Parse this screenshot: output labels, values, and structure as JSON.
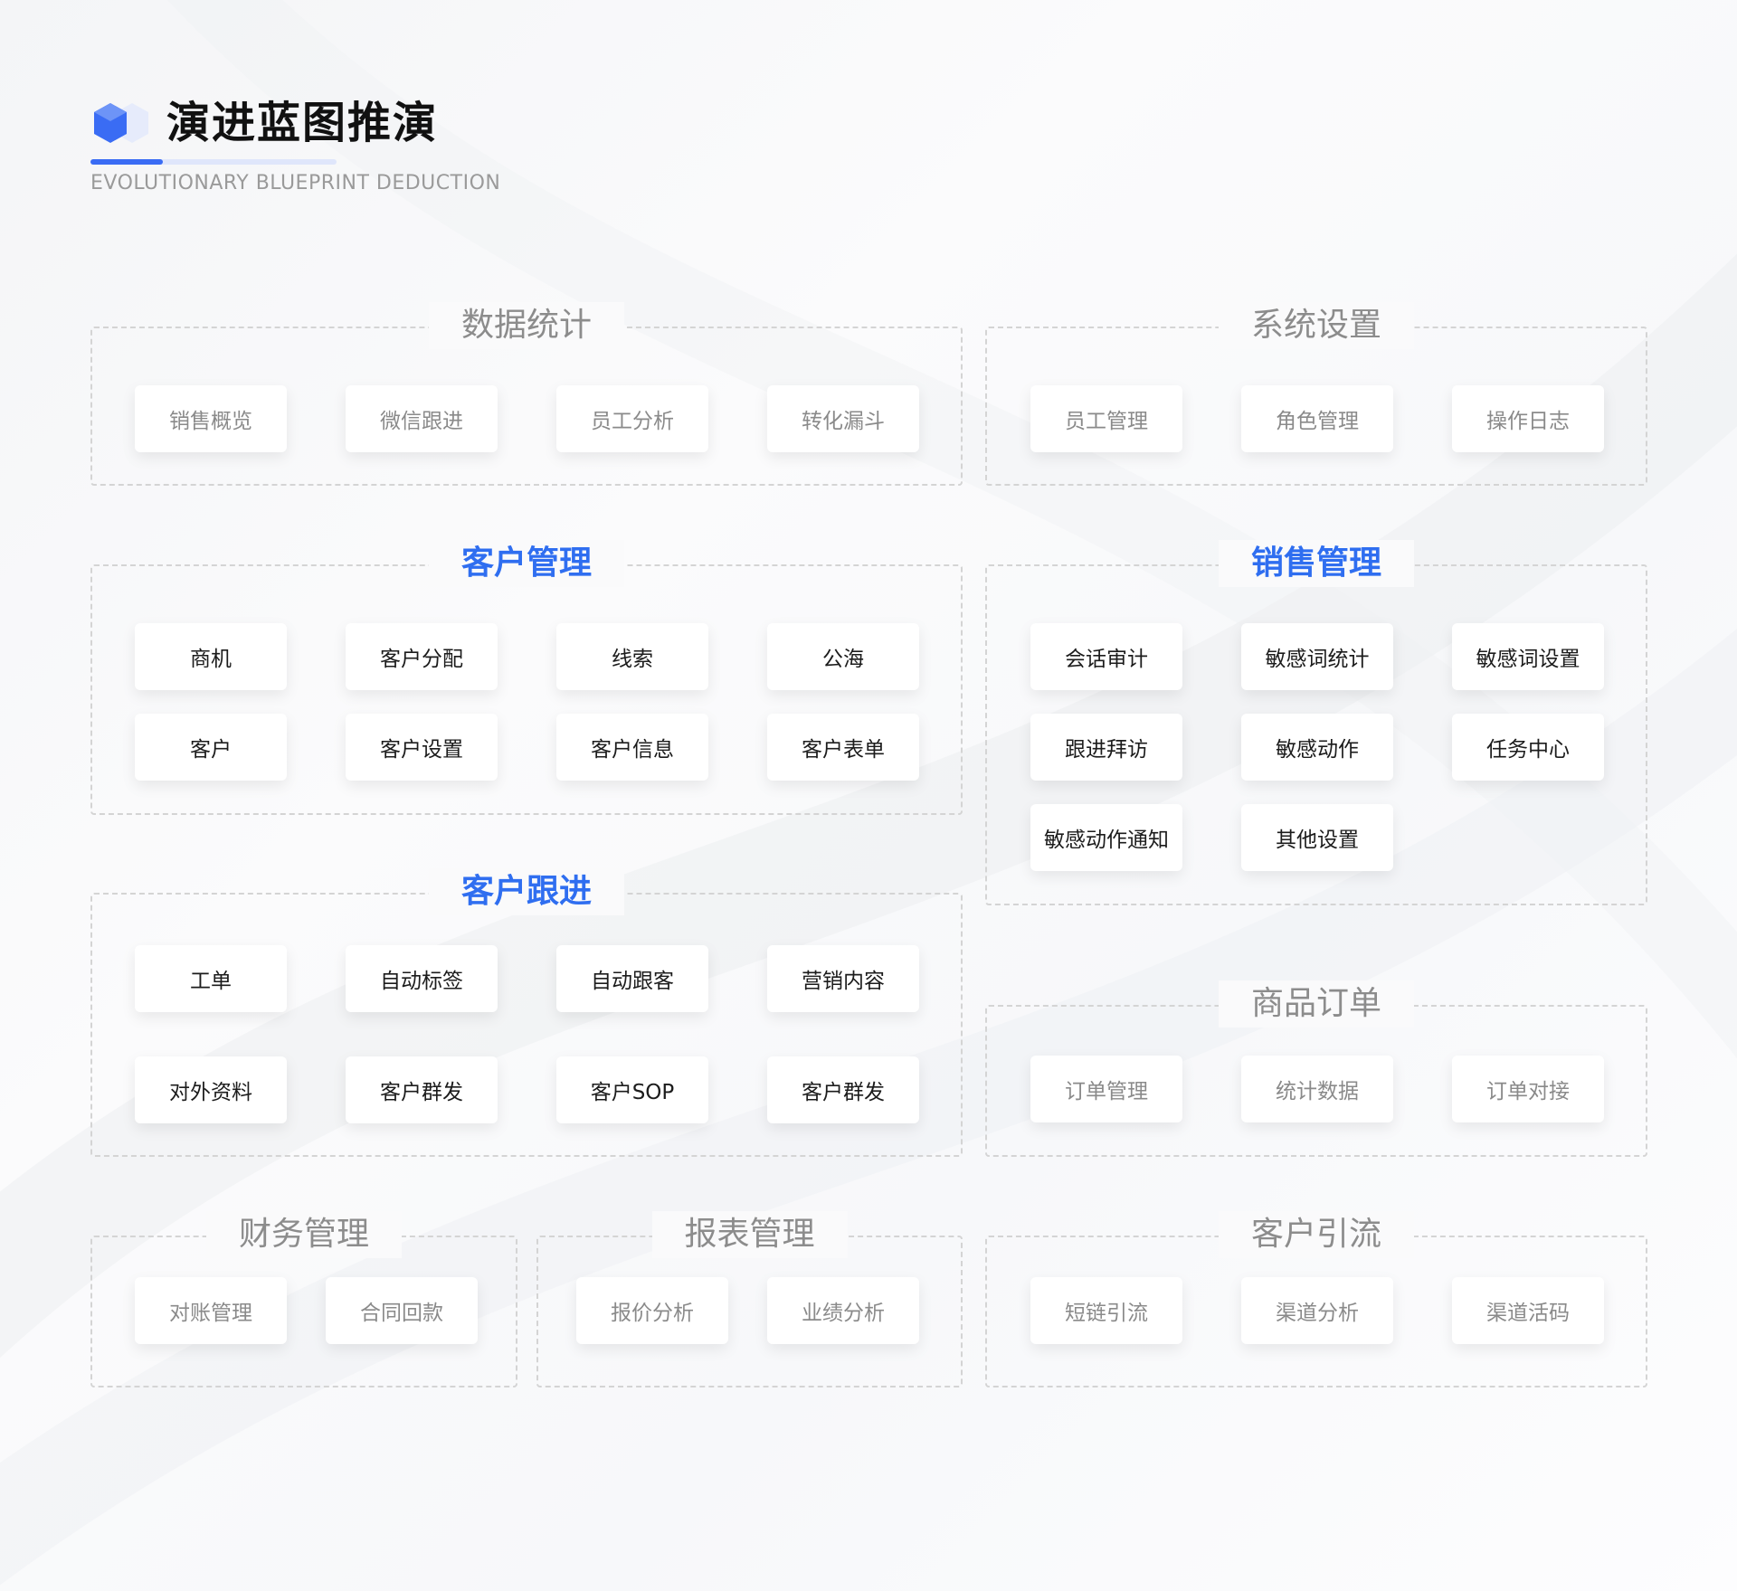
{
  "header": {
    "title": "演进蓝图推演",
    "subtitle": "EVOLUTIONARY BLUEPRINT DEDUCTION"
  },
  "colors": {
    "accent": "#2f6ef0",
    "muted_text": "#8a8a8a",
    "dark_text": "#1c1c1c",
    "border": "#d4d4d4"
  },
  "groups": [
    {
      "title": "数据统计",
      "highlight": false,
      "items": [
        "销售概览",
        "微信跟进",
        "员工分析",
        "转化漏斗"
      ]
    },
    {
      "title": "系统设置",
      "highlight": false,
      "items": [
        "员工管理",
        "角色管理",
        "操作日志"
      ]
    },
    {
      "title": "客户管理",
      "highlight": true,
      "items": [
        "商机",
        "客户分配",
        "线索",
        "公海",
        "客户",
        "客户设置",
        "客户信息",
        "客户表单"
      ]
    },
    {
      "title": "销售管理",
      "highlight": true,
      "items": [
        "会话审计",
        "敏感词统计",
        "敏感词设置",
        "跟进拜访",
        "敏感动作",
        "任务中心",
        "敏感动作通知",
        "其他设置"
      ]
    },
    {
      "title": "客户跟进",
      "highlight": true,
      "items": [
        "工单",
        "自动标签",
        "自动跟客",
        "营销内容",
        "对外资料",
        "客户群发",
        "客户SOP",
        "客户群发"
      ]
    },
    {
      "title": "商品订单",
      "highlight": false,
      "items": [
        "订单管理",
        "统计数据",
        "订单对接"
      ]
    },
    {
      "title": "财务管理",
      "highlight": false,
      "items": [
        "对账管理",
        "合同回款"
      ]
    },
    {
      "title": "报表管理",
      "highlight": false,
      "items": [
        "报价分析",
        "业绩分析"
      ]
    },
    {
      "title": "客户引流",
      "highlight": false,
      "items": [
        "短链引流",
        "渠道分析",
        "渠道活码"
      ]
    }
  ]
}
